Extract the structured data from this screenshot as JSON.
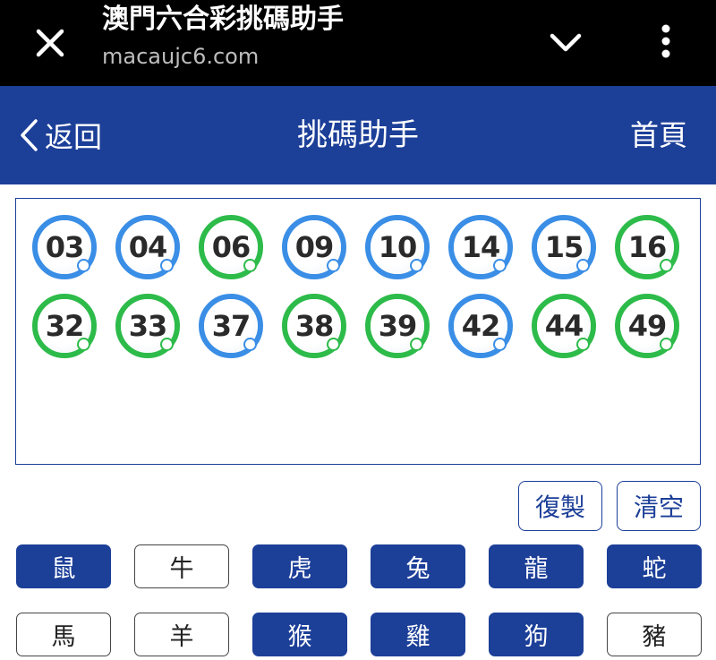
{
  "browser": {
    "title": "澳門六合彩挑碼助手",
    "url": "macaujc6.com"
  },
  "header": {
    "back_label": "返回",
    "title": "挑碼助手",
    "home_label": "首頁"
  },
  "colors": {
    "accent": "#1c3f98",
    "ball_blue": "#3a8ee6",
    "ball_green": "#2dbb4a"
  },
  "balls": [
    {
      "number": "03",
      "color": "blue"
    },
    {
      "number": "04",
      "color": "blue"
    },
    {
      "number": "06",
      "color": "green"
    },
    {
      "number": "09",
      "color": "blue"
    },
    {
      "number": "10",
      "color": "blue"
    },
    {
      "number": "14",
      "color": "blue"
    },
    {
      "number": "15",
      "color": "blue"
    },
    {
      "number": "16",
      "color": "green"
    },
    {
      "number": "32",
      "color": "green"
    },
    {
      "number": "33",
      "color": "green"
    },
    {
      "number": "37",
      "color": "blue"
    },
    {
      "number": "38",
      "color": "green"
    },
    {
      "number": "39",
      "color": "green"
    },
    {
      "number": "42",
      "color": "blue"
    },
    {
      "number": "44",
      "color": "green"
    },
    {
      "number": "49",
      "color": "green"
    }
  ],
  "actions": {
    "copy_label": "復製",
    "clear_label": "清空"
  },
  "zodiac": [
    {
      "label": "鼠",
      "selected": true
    },
    {
      "label": "牛",
      "selected": false
    },
    {
      "label": "虎",
      "selected": true
    },
    {
      "label": "兔",
      "selected": true
    },
    {
      "label": "龍",
      "selected": true
    },
    {
      "label": "蛇",
      "selected": true
    },
    {
      "label": "馬",
      "selected": false
    },
    {
      "label": "羊",
      "selected": false
    },
    {
      "label": "猴",
      "selected": true
    },
    {
      "label": "雞",
      "selected": true
    },
    {
      "label": "狗",
      "selected": true
    },
    {
      "label": "豬",
      "selected": false
    }
  ]
}
